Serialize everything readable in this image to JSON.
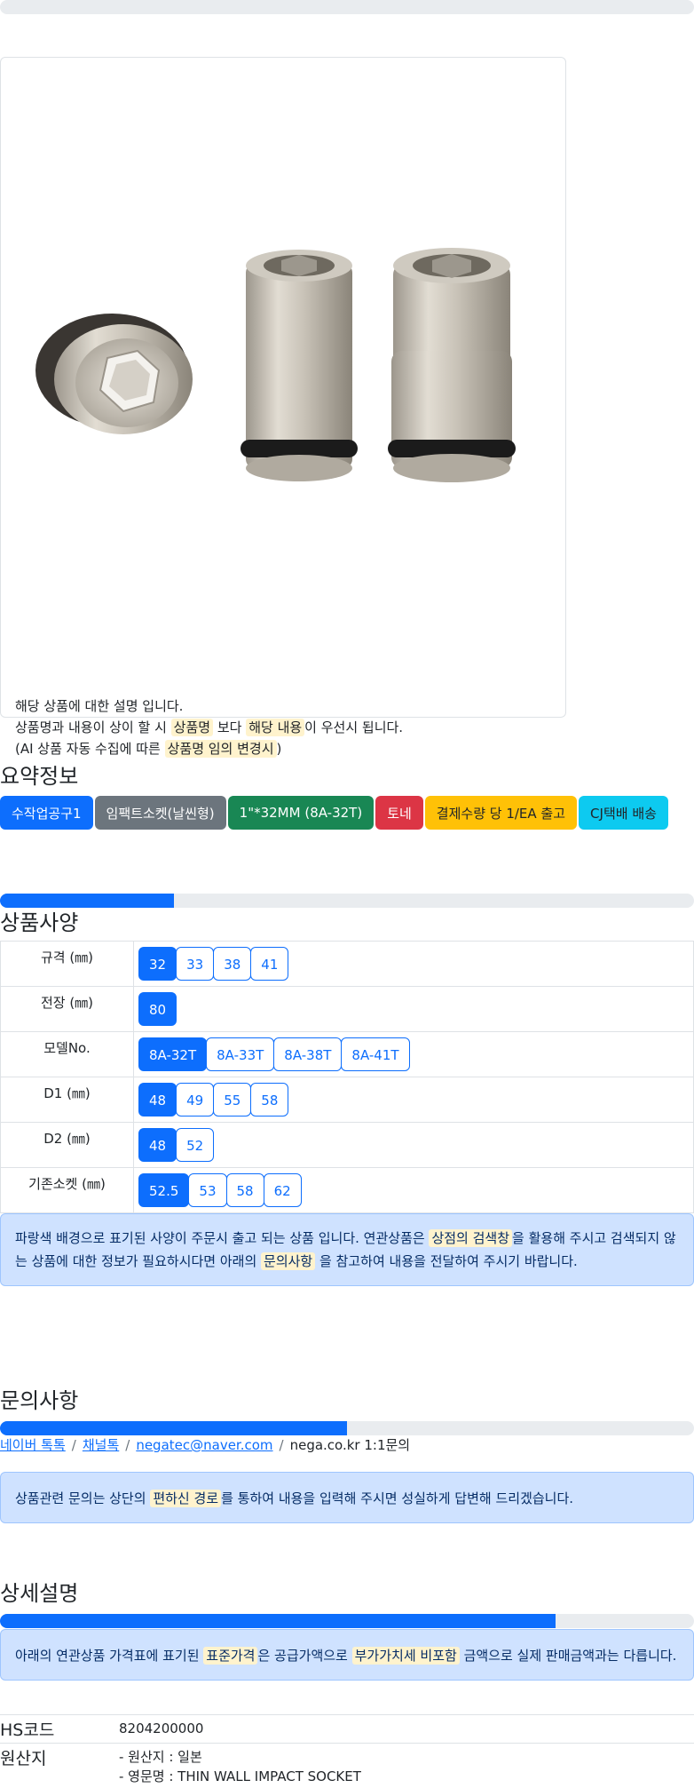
{
  "card": {
    "line1": "해당 상품에 대한 설명 입니다.",
    "line2_a": "상품명과 내용이 상이 할 시 ",
    "line2_hl1": "상품명",
    "line2_b": " 보다 ",
    "line2_hl2": "해당 내용",
    "line2_c": "이 우선시 됩니다.",
    "line3_a": "(AI 상품 자동 수집에 따른 ",
    "line3_hl": "상품명 임의 변경시",
    "line3_b": ")"
  },
  "summary": {
    "title": "요약정보",
    "badges": [
      {
        "label": "수작업공구1",
        "color": "#0d6efd",
        "text_color": "#ffffff"
      },
      {
        "label": "임팩트소켓(날씬형)",
        "color": "#6c757d",
        "text_color": "#ffffff"
      },
      {
        "label": "1\"*32MM (8A-32T)",
        "color": "#198754",
        "text_color": "#ffffff"
      },
      {
        "label": "토네",
        "color": "#dc3545",
        "text_color": "#ffffff"
      },
      {
        "label": "결제수량 당 1/EA 출고",
        "color": "#ffc107",
        "text_color": "#212529"
      },
      {
        "label": "CJ택배 배송",
        "color": "#0dcaf0",
        "text_color": "#212529"
      }
    ]
  },
  "spec": {
    "title": "상품사양",
    "progress": 0.25,
    "rows": [
      {
        "label": "규격 (㎜)",
        "values": [
          "32",
          "33",
          "38",
          "41"
        ],
        "selected": 0
      },
      {
        "label": "전장 (㎜)",
        "values": [
          "80"
        ],
        "selected": 0
      },
      {
        "label": "모델No.",
        "values": [
          "8A-32T",
          "8A-33T",
          "8A-38T",
          "8A-41T"
        ],
        "selected": 0
      },
      {
        "label": "D1 (㎜)",
        "values": [
          "48",
          "49",
          "55",
          "58"
        ],
        "selected": 0
      },
      {
        "label": "D2 (㎜)",
        "values": [
          "48",
          "52"
        ],
        "selected": 0
      },
      {
        "label": "기존소켓 (㎜)",
        "values": [
          "52.5",
          "53",
          "58",
          "62"
        ],
        "selected": 0
      }
    ],
    "notice_a": "파랑색 배경으로 표기된 사양이 주문시 출고 되는 상품 입니다. 연관상품은 ",
    "notice_hl1": "상점의 검색창",
    "notice_b": "을 활용해 주시고 검색되지 않는 상품에 대한 정보가 필요하시다면 아래의 ",
    "notice_hl2": "문의사항",
    "notice_c": " 을 참고하여 내용을 전달하여 주시기 바랍니다."
  },
  "inquiry": {
    "title": "문의사항",
    "progress": 0.5,
    "links": [
      "네이버 톡톡",
      "채널톡",
      "negatec@naver.com"
    ],
    "plain": "nega.co.kr 1:1문의",
    "notice_a": "상품관련 문의는 상단의 ",
    "notice_hl": "편하신 경로",
    "notice_b": "를 통하여 내용을 입력해 주시면 성실하게 답변해 드리겠습니다."
  },
  "detail": {
    "title": "상세설명",
    "progress": 0.8,
    "notice_a": "아래의 연관상품 가격표에 표기된 ",
    "notice_hl1": "표준가격",
    "notice_b": "은 공급가액으로 ",
    "notice_hl2": "부가가치세 비포함",
    "notice_c": " 금액으로 실제 판매금액과는 다릅니다.",
    "hs_label": "HS코드",
    "hs_value": "8204200000",
    "origin_label": "원산지",
    "origin_line1": "- 원산지 : 일본",
    "origin_line2": "- 영문명 : THIN WALL IMPACT SOCKET"
  }
}
